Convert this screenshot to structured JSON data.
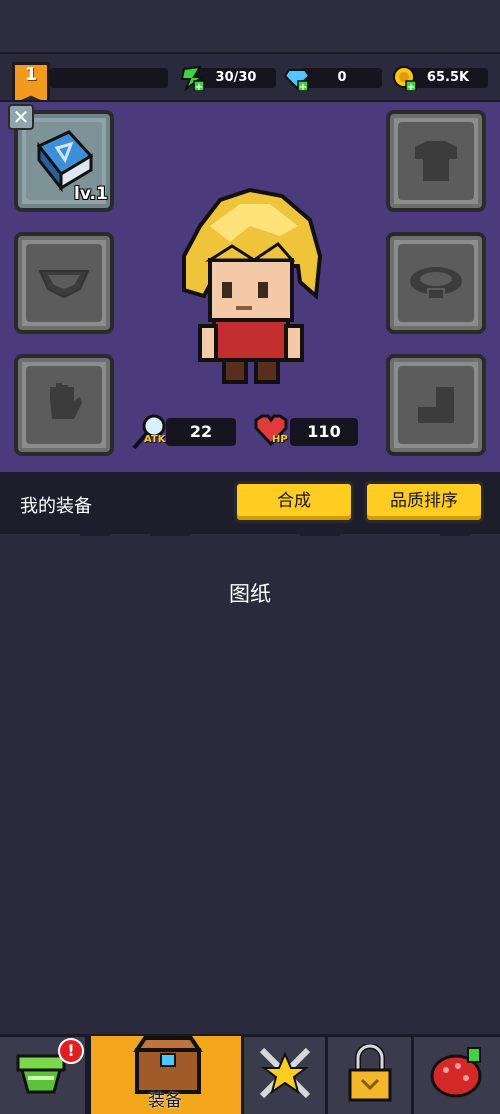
{
  "player": {
    "level": "1"
  },
  "resources": {
    "energy": "30/30",
    "gems": "0",
    "gold": "65.5K"
  },
  "equipment": {
    "book_level": "lv.1",
    "slots": [
      "book",
      "armor",
      "necklace",
      "ring",
      "glove",
      "boots"
    ]
  },
  "stats": {
    "atk_label": "ATK",
    "atk_value": "22",
    "hp_label": "HP",
    "hp_value": "110"
  },
  "section": {
    "title": "我的装备",
    "combine_label": "合成",
    "sort_label": "品质排序"
  },
  "content": {
    "blueprint_label": "图纸"
  },
  "nav": {
    "active_label": "装备",
    "items": [
      "shop-icon",
      "chest-icon",
      "swords-icon",
      "lock-icon",
      "gem-icon"
    ],
    "badge": "!"
  },
  "colors": {
    "panel": "#4b3a7c",
    "background": "#2b2a3c",
    "accent_yellow": "#ffcc22",
    "nav_active": "#f2a61c"
  }
}
